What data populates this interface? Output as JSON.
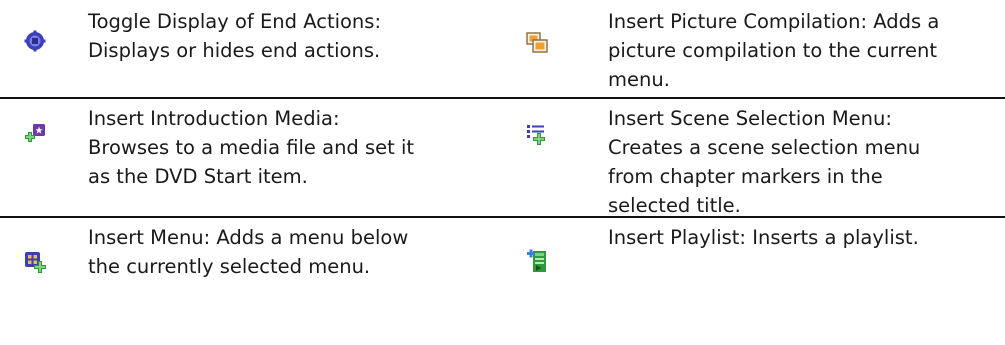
{
  "items": [
    {
      "left": {
        "icon": "toggle-end-actions-icon",
        "text": "Toggle Display of End Actions: Displays or hides end actions."
      },
      "right": {
        "icon": "picture-compilation-icon",
        "text": "Insert Picture Compilation: Adds a picture compilation to the current menu."
      }
    },
    {
      "left": {
        "icon": "insert-introduction-media-icon",
        "text": "Insert Introduction Media: Browses to a media file and set it as the DVD Start item."
      },
      "right": {
        "icon": "scene-selection-menu-icon",
        "text": "Insert Scene Selection Menu: Creates a scene selection menu from chapter markers in the selected title."
      }
    },
    {
      "left": {
        "icon": "insert-menu-icon",
        "text": "Insert Menu: Adds a menu below the currently selected menu."
      },
      "right": {
        "icon": "insert-playlist-icon",
        "text": "Insert Playlist: Inserts a playlist."
      }
    }
  ],
  "colors": {
    "text": "#1a1a1a",
    "rule": "#111111",
    "icon_blue": "#3b3fb8",
    "icon_green": "#2f9a3a",
    "icon_orange": "#f0a030",
    "icon_purple": "#6a3aa8"
  }
}
